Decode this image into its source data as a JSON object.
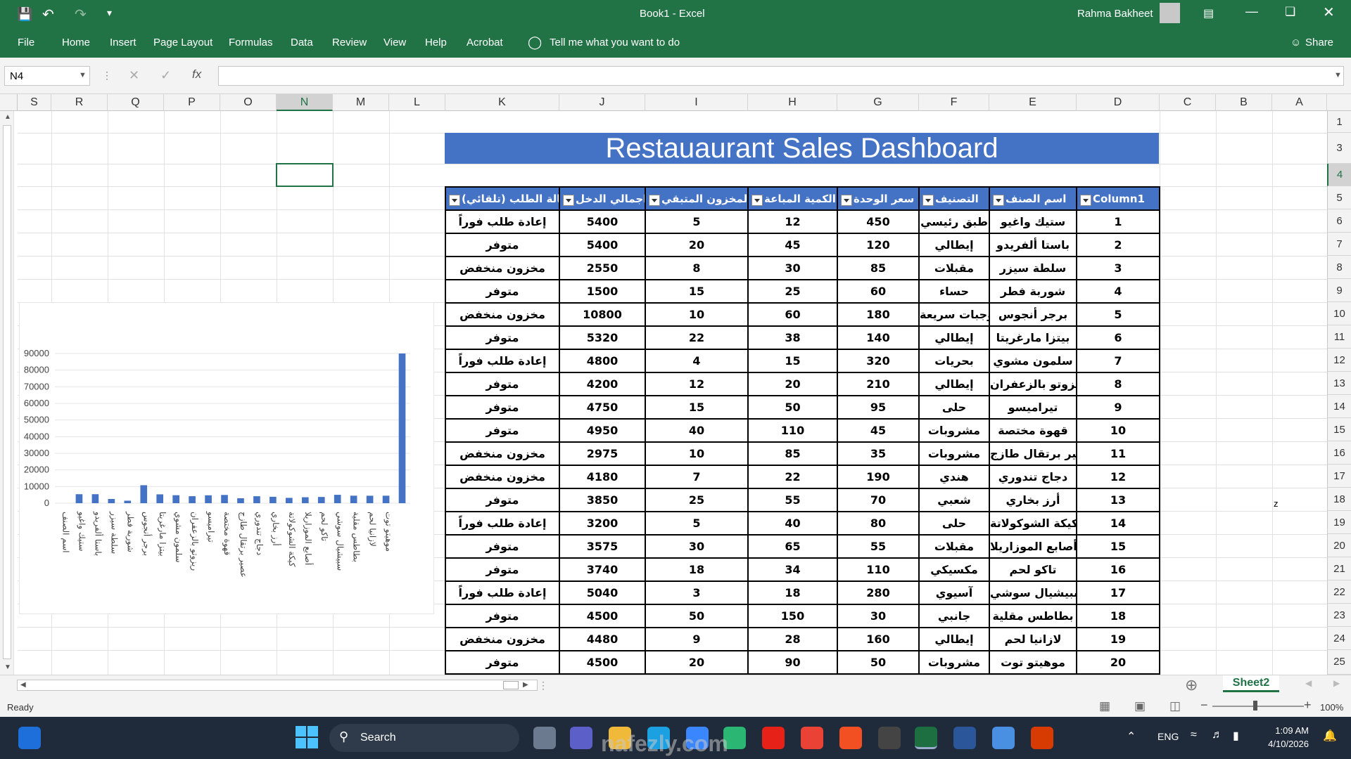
{
  "window": {
    "title": "Book1  -  Excel",
    "user": "Rahma Bakheet"
  },
  "menu": {
    "items": [
      "File",
      "Home",
      "Insert",
      "Page Layout",
      "Formulas",
      "Data",
      "Review",
      "View",
      "Help",
      "Acrobat"
    ],
    "tell_me": "Tell me what you want to do",
    "share": "Share"
  },
  "formula_bar": {
    "name_box": "N4",
    "fx": "fx",
    "content": ""
  },
  "columns": [
    "S",
    "R",
    "Q",
    "P",
    "O",
    "N",
    "M",
    "L",
    "K",
    "J",
    "I",
    "H",
    "G",
    "F",
    "E",
    "D",
    "C",
    "B",
    "A"
  ],
  "selected_column": "N",
  "rows": [
    "1",
    "3",
    "4",
    "5",
    "6",
    "7",
    "8",
    "9",
    "10",
    "11",
    "12",
    "13",
    "14",
    "15",
    "16",
    "17",
    "18",
    "19",
    "20",
    "21",
    "22",
    "23",
    "24",
    "25"
  ],
  "selected_row": "4",
  "stray_cell_text": "z",
  "dashboard_title": "Restauaurant Sales  Dashboard",
  "table": {
    "headers": [
      "حالة الطلب (تلقائي)",
      "اجمالي الدخل",
      "المخزون المتبقي",
      "الكمية المباعة",
      "سعر الوحدة",
      "التصنيف",
      "اسم الصنف",
      "Column1"
    ],
    "rows": [
      [
        "إعادة طلب فوراً",
        "5400",
        "5",
        "12",
        "450",
        "طبق رئيسي",
        "ستيك واغيو",
        "1"
      ],
      [
        "متوفر",
        "5400",
        "20",
        "45",
        "120",
        "إيطالي",
        "باستا ألفريدو",
        "2"
      ],
      [
        "مخزون منخفض",
        "2550",
        "8",
        "30",
        "85",
        "مقبلات",
        "سلطة سيزر",
        "3"
      ],
      [
        "متوفر",
        "1500",
        "15",
        "25",
        "60",
        "حساء",
        "شوربة فطر",
        "4"
      ],
      [
        "مخزون منخفض",
        "10800",
        "10",
        "60",
        "180",
        "وجبات سريعة",
        "برجر أنجوس",
        "5"
      ],
      [
        "متوفر",
        "5320",
        "22",
        "38",
        "140",
        "إيطالي",
        "بيتزا مارغريتا",
        "6"
      ],
      [
        "إعادة طلب فوراً",
        "4800",
        "4",
        "15",
        "320",
        "بحريات",
        "سلمون مشوي",
        "7"
      ],
      [
        "متوفر",
        "4200",
        "12",
        "20",
        "210",
        "إيطالي",
        "ريزوتو بالزعفران",
        "8"
      ],
      [
        "متوفر",
        "4750",
        "15",
        "50",
        "95",
        "حلى",
        "تيراميسو",
        "9"
      ],
      [
        "متوفر",
        "4950",
        "40",
        "110",
        "45",
        "مشروبات",
        "قهوة مختصة",
        "10"
      ],
      [
        "مخزون منخفض",
        "2975",
        "10",
        "85",
        "35",
        "مشروبات",
        "عصير برتقال طازج",
        "11"
      ],
      [
        "مخزون منخفض",
        "4180",
        "7",
        "22",
        "190",
        "هندي",
        "دجاج تندوري",
        "12"
      ],
      [
        "متوفر",
        "3850",
        "25",
        "55",
        "70",
        "شعبي",
        "أرز بخاري",
        "13"
      ],
      [
        "إعادة طلب فوراً",
        "3200",
        "5",
        "40",
        "80",
        "حلى",
        "كيكة الشوكولاتة",
        "14"
      ],
      [
        "متوفر",
        "3575",
        "30",
        "65",
        "55",
        "مقبلات",
        "أصابع الموزاريلا",
        "15"
      ],
      [
        "متوفر",
        "3740",
        "18",
        "34",
        "110",
        "مكسيكي",
        "تاكو لحم",
        "16"
      ],
      [
        "إعادة طلب فوراً",
        "5040",
        "3",
        "18",
        "280",
        "آسيوي",
        "سبيشيال سوشي",
        "17"
      ],
      [
        "متوفر",
        "4500",
        "50",
        "150",
        "30",
        "جانبي",
        "بطاطس مقلية",
        "18"
      ],
      [
        "مخزون منخفض",
        "4480",
        "9",
        "28",
        "160",
        "إيطالي",
        "لازانيا لحم",
        "19"
      ],
      [
        "متوفر",
        "4500",
        "20",
        "90",
        "50",
        "مشروبات",
        "موهيتو توت",
        "20"
      ]
    ]
  },
  "chart_data": {
    "type": "bar",
    "categories": [
      "اسم الصنف",
      "ستيك واغيو",
      "باستا ألفريدو",
      "سلطة سيزر",
      "شوربة فطر",
      "برجر أنجوس",
      "بيتزا مارغريتا",
      "سلمون مشوي",
      "ريزوتو بالزعفران",
      "تيراميسو",
      "قهوة مختصة",
      "عصير برتقال طازج",
      "دجاج تندوري",
      "أرز بخاري",
      "كيكة الشوكولاتة",
      "أصابع الموزاريلا",
      "تاكو لحم",
      "سبيشيال سوشي",
      "بطاطس مقلية",
      "لازانيا لحم",
      "موهيتو توت",
      ""
    ],
    "values": [
      0,
      5400,
      5400,
      2550,
      1500,
      10800,
      5320,
      4800,
      4200,
      4750,
      4950,
      2975,
      4180,
      3850,
      3200,
      3575,
      3740,
      5040,
      4500,
      4480,
      4500,
      90000
    ],
    "yticks": [
      "90000",
      "80000",
      "70000",
      "60000",
      "50000",
      "40000",
      "30000",
      "20000",
      "10000",
      "0"
    ],
    "ylim": [
      0,
      90000
    ],
    "color": "#4472c4"
  },
  "sheet_tabs": [
    "Sheet2"
  ],
  "status": {
    "ready": "Ready",
    "zoom": "100%"
  },
  "taskbar": {
    "search": "Search",
    "lang": "ENG",
    "time": "1:09 AM",
    "date": "4/10/2026"
  },
  "watermark": "nafezly.com"
}
